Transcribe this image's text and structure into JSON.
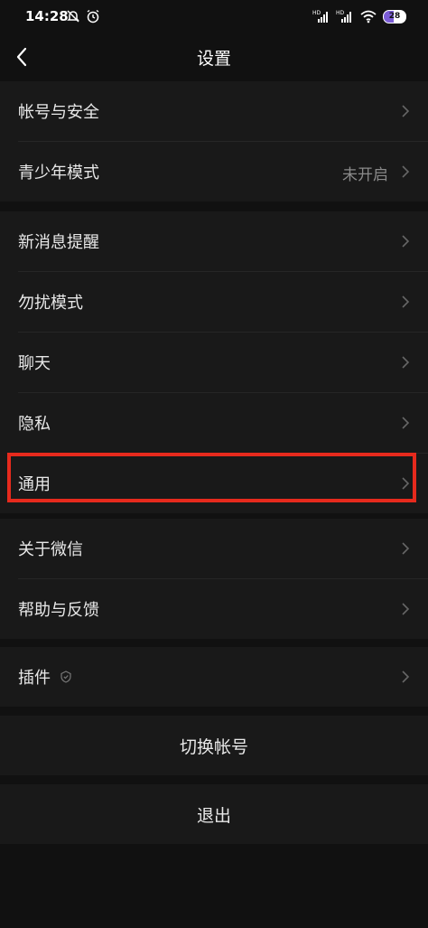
{
  "status_bar": {
    "time": "14:28",
    "battery": "28",
    "network_1": "HD",
    "network_2": "HD"
  },
  "nav": {
    "title": "设置",
    "back_icon": "chevron-left-icon"
  },
  "groups": [
    {
      "items": [
        {
          "label": "帐号与安全",
          "value": ""
        },
        {
          "label": "青少年模式",
          "value": "未开启"
        }
      ]
    },
    {
      "items": [
        {
          "label": "新消息提醒"
        },
        {
          "label": "勿扰模式"
        },
        {
          "label": "聊天"
        },
        {
          "label": "隐私"
        },
        {
          "label": "通用"
        }
      ]
    },
    {
      "items": [
        {
          "label": "关于微信"
        },
        {
          "label": "帮助与反馈"
        }
      ]
    },
    {
      "items": [
        {
          "label": "插件",
          "icon": "plugin-icon"
        }
      ]
    }
  ],
  "buttons": {
    "switch_account": "切换帐号",
    "logout": "退出"
  },
  "colors": {
    "background": "#111111",
    "cell": "#191919",
    "highlight": "#e62a1d",
    "muted_text": "#8a8a8a"
  }
}
